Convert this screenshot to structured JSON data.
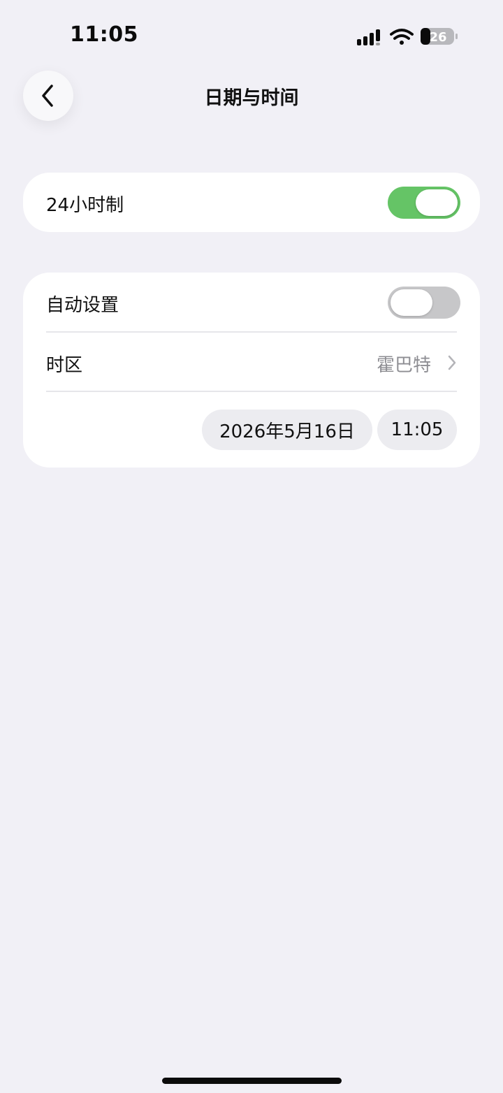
{
  "status_bar": {
    "time": "11:05",
    "battery_level": "26",
    "icons": [
      "cellular-signal-icon",
      "wifi-icon",
      "battery-icon"
    ]
  },
  "header": {
    "title": "日期与时间",
    "back_icon": "chevron-left-icon"
  },
  "section_format": {
    "label": "24小时制",
    "toggle_on": true
  },
  "section_datetime": {
    "auto_set": {
      "label": "自动设置",
      "toggle_on": false
    },
    "timezone": {
      "label": "时区",
      "value": "霍巴特",
      "icon": "chevron-right-icon"
    },
    "date_value": "2026年5月16日",
    "time_value": "11:05"
  },
  "colors": {
    "background": "#f1f0f6",
    "card": "#ffffff",
    "toggle_on": "#65c466",
    "toggle_off": "#c7c7c9",
    "secondary_text": "#8e8e93"
  }
}
